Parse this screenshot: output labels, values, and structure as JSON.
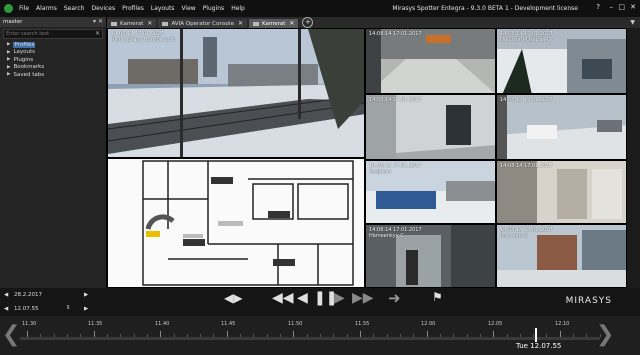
{
  "menubar": {
    "items": [
      "File",
      "Alarms",
      "Search",
      "Devices",
      "Profiles",
      "Layouts",
      "View",
      "Plugins",
      "Help"
    ],
    "title": "Mirasys Spotter Entegra - 9.3.0 BETA 1 - Development license"
  },
  "sidebar": {
    "header": "master",
    "search_placeholder": "Enter search text",
    "items": [
      {
        "label": "Profiles"
      },
      {
        "label": "Layouts"
      },
      {
        "label": "Plugins"
      },
      {
        "label": "Bookmarks"
      },
      {
        "label": "Saved tabs"
      }
    ]
  },
  "tabs": [
    {
      "label": "Kamerat"
    },
    {
      "label": "AVIA Operator Console"
    },
    {
      "label": "Kamerat"
    }
  ],
  "cameras": [
    {
      "ts": "14:08:14 17.01.2017",
      "name": "Raiderpääsy Outside poin"
    },
    {
      "ts": "14:08:14 17.01.2017",
      "name": ""
    },
    {
      "ts": "14:08:14 17.01.2017",
      "name": "Ouluvaari-Lisäpää-C"
    },
    {
      "ts": "14:08:14 17.01.2017",
      "name": ""
    },
    {
      "ts": "14:08:14 17.01.2017",
      "name": ""
    },
    {
      "ts": "14:08:14 17.01.2017",
      "name": ""
    },
    {
      "ts": "14:08:14 17.01.2017",
      "name": "Kotijakso"
    },
    {
      "ts": "14:08:14 17.01.2017",
      "name": ""
    },
    {
      "ts": "14:08:14 17.01.2017",
      "name": "Hämeenkyy C"
    },
    {
      "ts": "14:08:14 17.01.2017",
      "name": "Juno-sanna"
    }
  ],
  "controls": {
    "date": "28.2.2017",
    "time": "12.07.55",
    "brand": "MIRASYS"
  },
  "timeline": {
    "ticks": [
      "11.30",
      "11.35",
      "11.40",
      "11.45",
      "11.50",
      "11.55",
      "12.00",
      "12.05",
      "12.10"
    ],
    "current": "Tue 12.07.55"
  }
}
